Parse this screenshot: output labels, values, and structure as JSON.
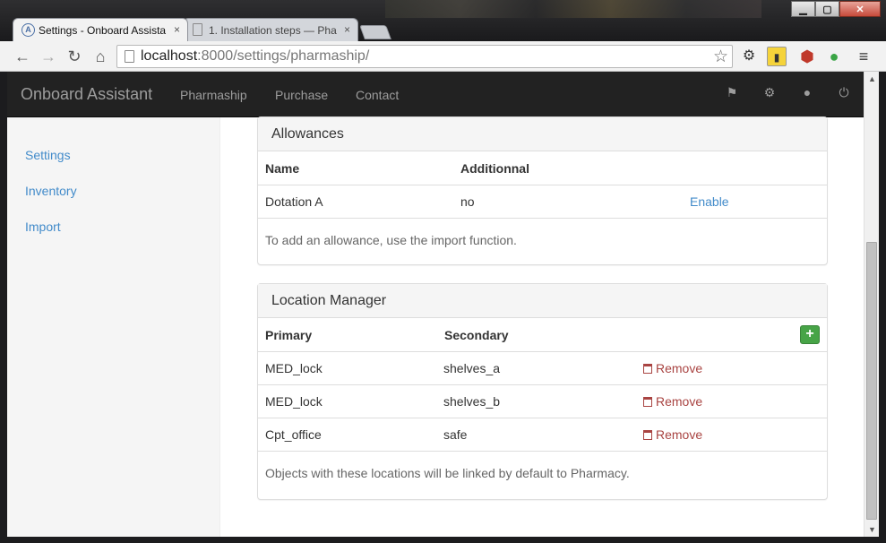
{
  "window": {
    "controls": {
      "minimize": "▁",
      "maximize": "▢",
      "close": "✕"
    }
  },
  "tabs": [
    {
      "title": "Settings - Onboard Assista",
      "icon": "app-logo-icon",
      "close": "×"
    },
    {
      "title": "1. Installation steps — Pha",
      "icon": "page-icon",
      "close": "×"
    }
  ],
  "address_bar": {
    "host": "localhost",
    "rest": ":8000/settings/pharmaship/"
  },
  "navbar": {
    "brand": "Onboard Assistant",
    "links": [
      "Pharmaship",
      "Purchase",
      "Contact"
    ],
    "icons": [
      "flag-icon",
      "gear-icon",
      "user-icon",
      "power-icon"
    ]
  },
  "sidebar": {
    "items": [
      "Settings",
      "Inventory",
      "Import"
    ]
  },
  "allowances": {
    "title": "Allowances",
    "headers": [
      "Name",
      "Additionnal"
    ],
    "rows": [
      {
        "name": "Dotation A",
        "additional": "no",
        "action": "Enable"
      }
    ],
    "note": "To add an allowance, use the import function."
  },
  "location_manager": {
    "title": "Location Manager",
    "headers": [
      "Primary",
      "Secondary"
    ],
    "add_label": "+",
    "rows": [
      {
        "primary": "MED_lock",
        "secondary": "shelves_a",
        "action": "Remove"
      },
      {
        "primary": "MED_lock",
        "secondary": "shelves_b",
        "action": "Remove"
      },
      {
        "primary": "Cpt_office",
        "secondary": "safe",
        "action": "Remove"
      }
    ],
    "note": "Objects with these locations will be linked by default to Pharmacy."
  },
  "colors": {
    "navbar": "#222222",
    "link": "#428bca",
    "danger": "#a94442",
    "success": "#47a447"
  }
}
